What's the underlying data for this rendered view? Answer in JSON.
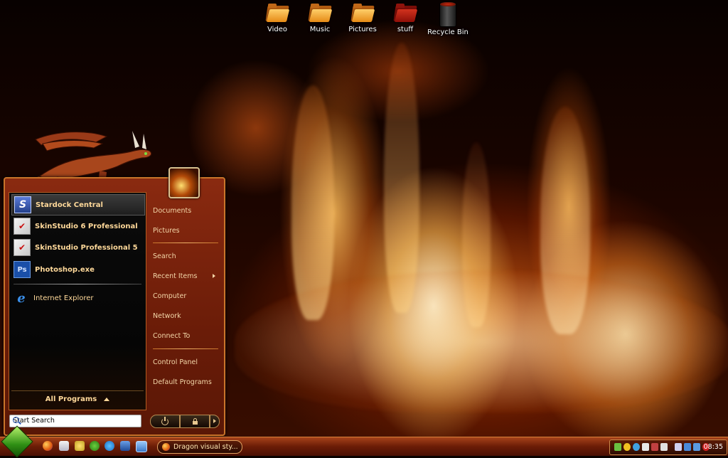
{
  "desktop": {
    "icons": [
      {
        "label": "Video",
        "icon": "folder-icon"
      },
      {
        "label": "Music",
        "icon": "folder-icon"
      },
      {
        "label": "Pictures",
        "icon": "folder-icon"
      },
      {
        "label": "stuff",
        "icon": "folder-red-icon"
      },
      {
        "label": "Recycle Bin",
        "icon": "recycle-bin-icon"
      }
    ]
  },
  "start_menu": {
    "pinned": [
      {
        "label": "Stardock Central",
        "icon": "stardock-icon"
      },
      {
        "label": "SkinStudio 6 Professional",
        "icon": "skinstudio-icon"
      },
      {
        "label": "SkinStudio Professional 5",
        "icon": "skinstudio-icon"
      },
      {
        "label": "Photoshop.exe",
        "icon": "photoshop-icon",
        "icon_text": "Ps"
      }
    ],
    "recent": [
      {
        "label": "Internet Explorer",
        "icon": "internet-explorer-icon"
      }
    ],
    "all_programs": "All Programs",
    "right_column": {
      "documents": "Documents",
      "pictures": "Pictures",
      "search": "Search",
      "recent_items": "Recent Items",
      "computer": "Computer",
      "network": "Network",
      "connect_to": "Connect To",
      "control_panel": "Control Panel",
      "default_programs": "Default Programs"
    },
    "search_placeholder": "Start Search"
  },
  "taskbar": {
    "active_window": "Dragon visual sty...",
    "clock": "08:35",
    "colors": {
      "accent": "#c9742a",
      "orb": "#2f8f14"
    }
  }
}
